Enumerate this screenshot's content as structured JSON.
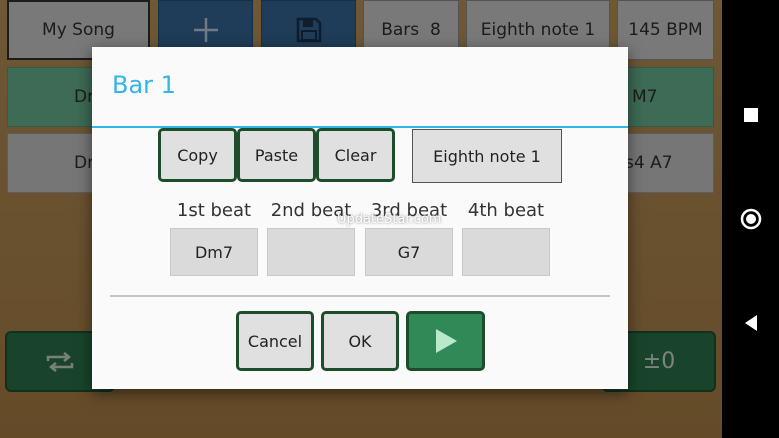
{
  "toolbar": {
    "song_name": "My Song",
    "add_icon": "plus-icon",
    "save_icon": "floppy-disk-icon",
    "bars_label": "Bars",
    "bars_value": "8",
    "note_value": "Eighth note 1",
    "tempo": "145 BPM"
  },
  "rows": [
    {
      "left": "Dr",
      "right": "M7"
    },
    {
      "left": "Dr",
      "right": "s4  A7"
    }
  ],
  "bottom_bar": {
    "loop_icon": "repeat-icon",
    "transpose_label": "±0"
  },
  "dialog": {
    "title": "Bar 1",
    "actions": {
      "copy": "Copy",
      "paste": "Paste",
      "clear": "Clear"
    },
    "note_selector": "Eighth note 1",
    "beats": [
      {
        "label": "1st beat",
        "chord": "Dm7"
      },
      {
        "label": "2nd beat",
        "chord": ""
      },
      {
        "label": "3rd beat",
        "chord": "G7"
      },
      {
        "label": "4th beat",
        "chord": ""
      }
    ],
    "footer": {
      "cancel": "Cancel",
      "ok": "OK",
      "play_icon": "play-icon"
    },
    "watermark": "UpdateStar.com"
  },
  "colors": {
    "accent": "#33b5e5",
    "button_green": "#2f7d4f",
    "button_border": "#1e4d2b",
    "toolbar_blue": "#3a6ea1"
  },
  "system_nav": {
    "recent": "square-icon",
    "home": "circle-icon",
    "back": "triangle-back-icon"
  }
}
